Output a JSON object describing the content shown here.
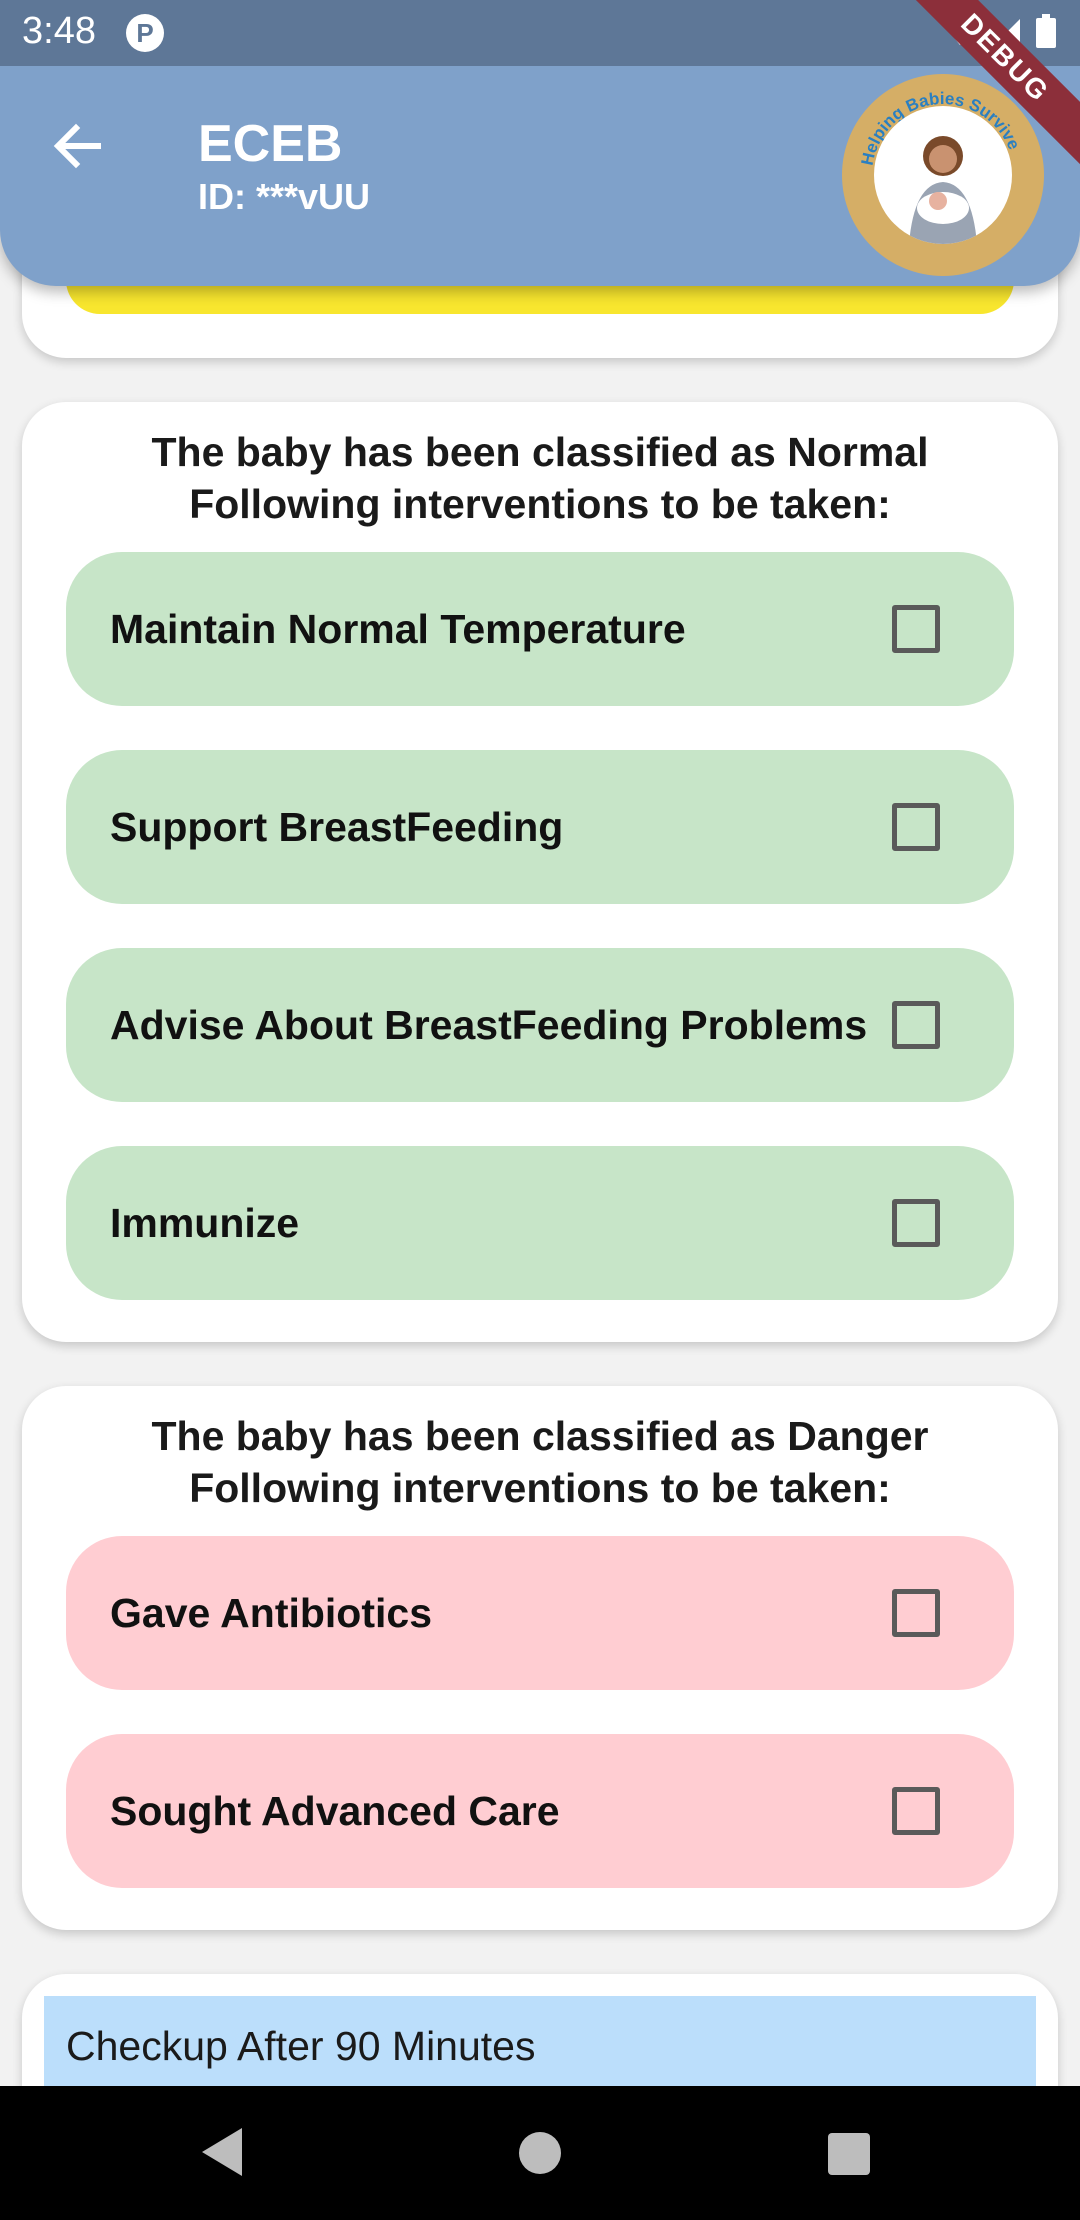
{
  "status_bar": {
    "time": "3:48"
  },
  "app_bar": {
    "title": "ECEB",
    "id_text": "ID: ***vUU",
    "logo_text": "Helping Babies Survive",
    "debug_label": "DEBUG"
  },
  "normal_card": {
    "heading_line1": "The baby has been classified as Normal",
    "heading_line2": "Following interventions to be taken:",
    "items": [
      {
        "label": "Maintain Normal Temperature",
        "checked": false
      },
      {
        "label": "Support BreastFeeding",
        "checked": false
      },
      {
        "label": "Advise About BreastFeeding Problems",
        "checked": false
      },
      {
        "label": "Immunize",
        "checked": false
      }
    ]
  },
  "danger_card": {
    "heading_line1": "The baby has been classified as Danger",
    "heading_line2": "Following interventions to be taken:",
    "items": [
      {
        "label": "Gave Antibiotics",
        "checked": false
      },
      {
        "label": "Sought Advanced Care",
        "checked": false
      }
    ]
  },
  "checkup_card": {
    "title": "Checkup After 90 Minutes"
  },
  "colors": {
    "app_bar": "#7fa1ca",
    "status_bar": "#5e7797",
    "normal_item": "#c7e5c8",
    "danger_item": "#ffcdd2",
    "checkup_header": "#bbdefb",
    "top_strip": "#f8e62e"
  }
}
